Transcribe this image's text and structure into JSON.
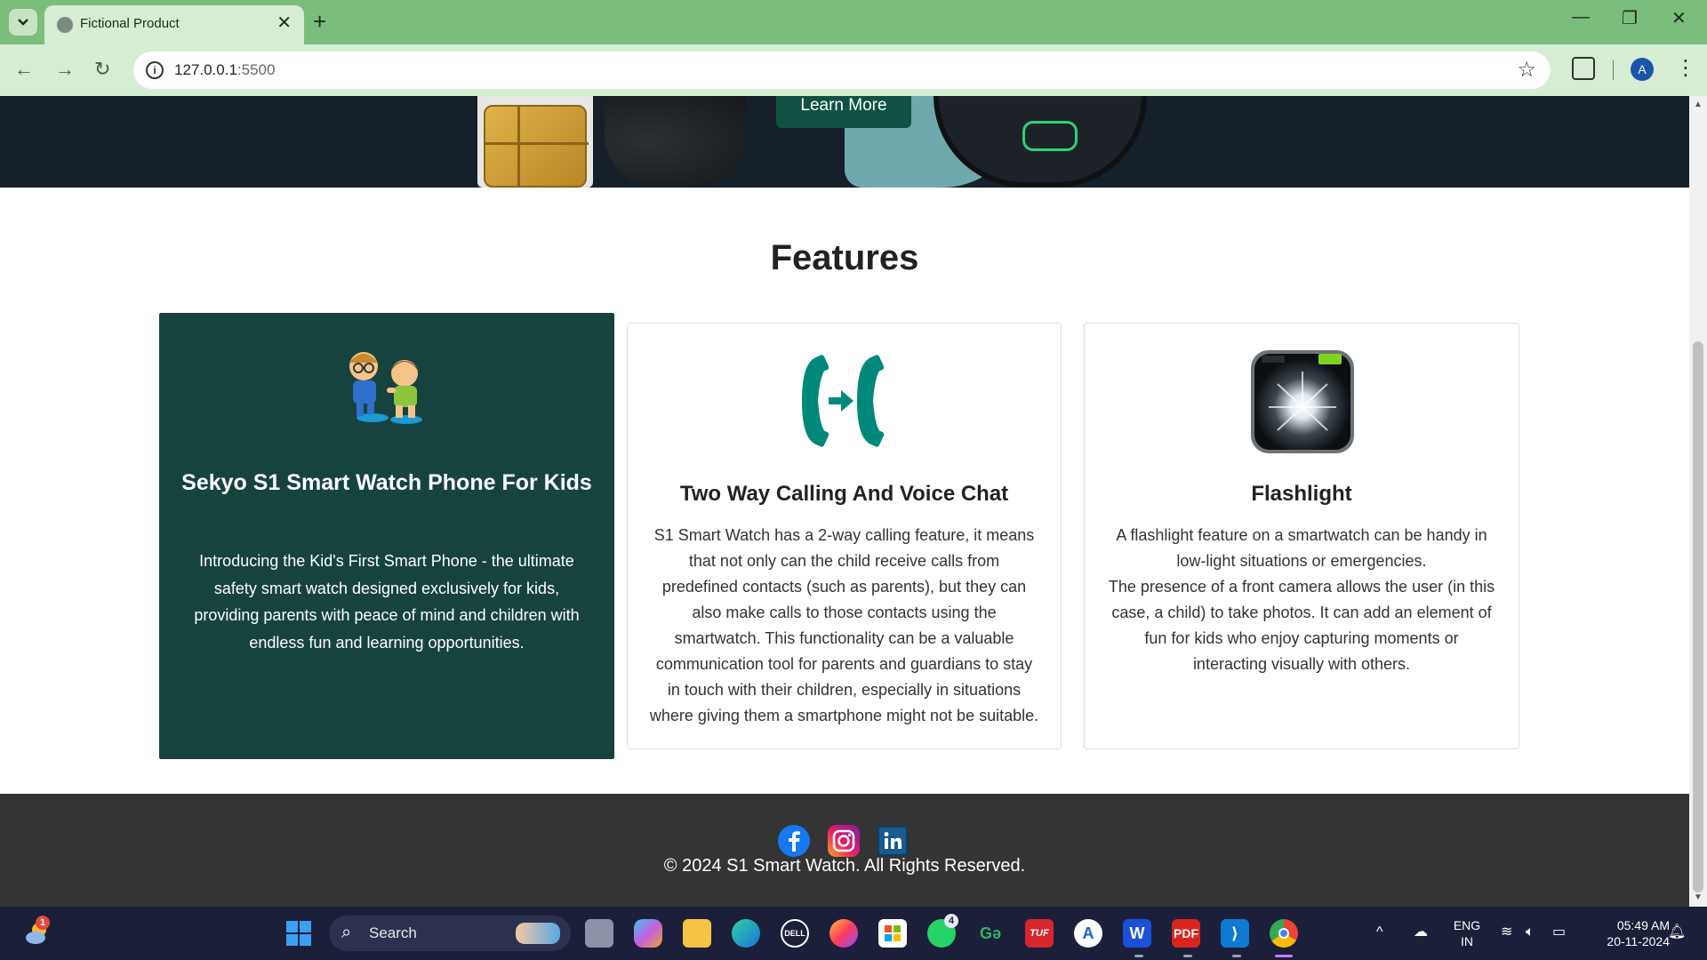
{
  "browser": {
    "tab_title": "Fictional Product",
    "url_host": "127.0.0.1",
    "url_port": ":5500",
    "profile_initial": "A"
  },
  "hero": {
    "button_label": "Learn More"
  },
  "features": {
    "title": "Features",
    "cards": [
      {
        "title": "Sekyo S1 Smart Watch Phone For Kids",
        "text": "Introducing the Kid's First Smart Phone - the ultimate safety smart watch designed exclusively for kids, providing parents with peace of mind and children with endless fun and learning opportunities.",
        "icon": "kids-illustration-icon"
      },
      {
        "title": "Two Way Calling And Voice Chat",
        "text": "S1 Smart Watch has a 2-way calling feature, it means that not only can the child receive calls from predefined contacts (such as parents), but they can also make calls to those contacts using the smartwatch. This functionality can be a valuable communication tool for parents and guardians to stay in touch with their children, especially in situations where giving them a smartphone might not be suitable.",
        "icon": "two-way-call-icon"
      },
      {
        "title": "Flashlight",
        "text_line1": "A flashlight feature on a smartwatch can be handy in low-light situations or emergencies.",
        "text_line2": "The presence of a front camera allows the user (in this case, a child) to take photos. It can add an element of fun for kids who enjoy capturing moments or interacting visually with others.",
        "icon": "flashlight-icon"
      }
    ]
  },
  "footer": {
    "social": [
      "facebook-icon",
      "instagram-icon",
      "linkedin-icon"
    ],
    "copyright": "© 2024 S1 Smart Watch. All Rights Reserved."
  },
  "taskbar": {
    "search_label": "Search",
    "weather_badge": "1",
    "whatsapp_badge": "4",
    "lang_line1": "ENG",
    "lang_line2": "IN",
    "time": "05:49 AM",
    "date": "20-11-2024"
  },
  "colors": {
    "tabbar": "#7bbd7b",
    "toolbar": "#d6ecd3",
    "card_dark": "#17433f",
    "accent_teal": "#00897b",
    "footer": "#343434",
    "taskbar": "#1b1f3a"
  }
}
